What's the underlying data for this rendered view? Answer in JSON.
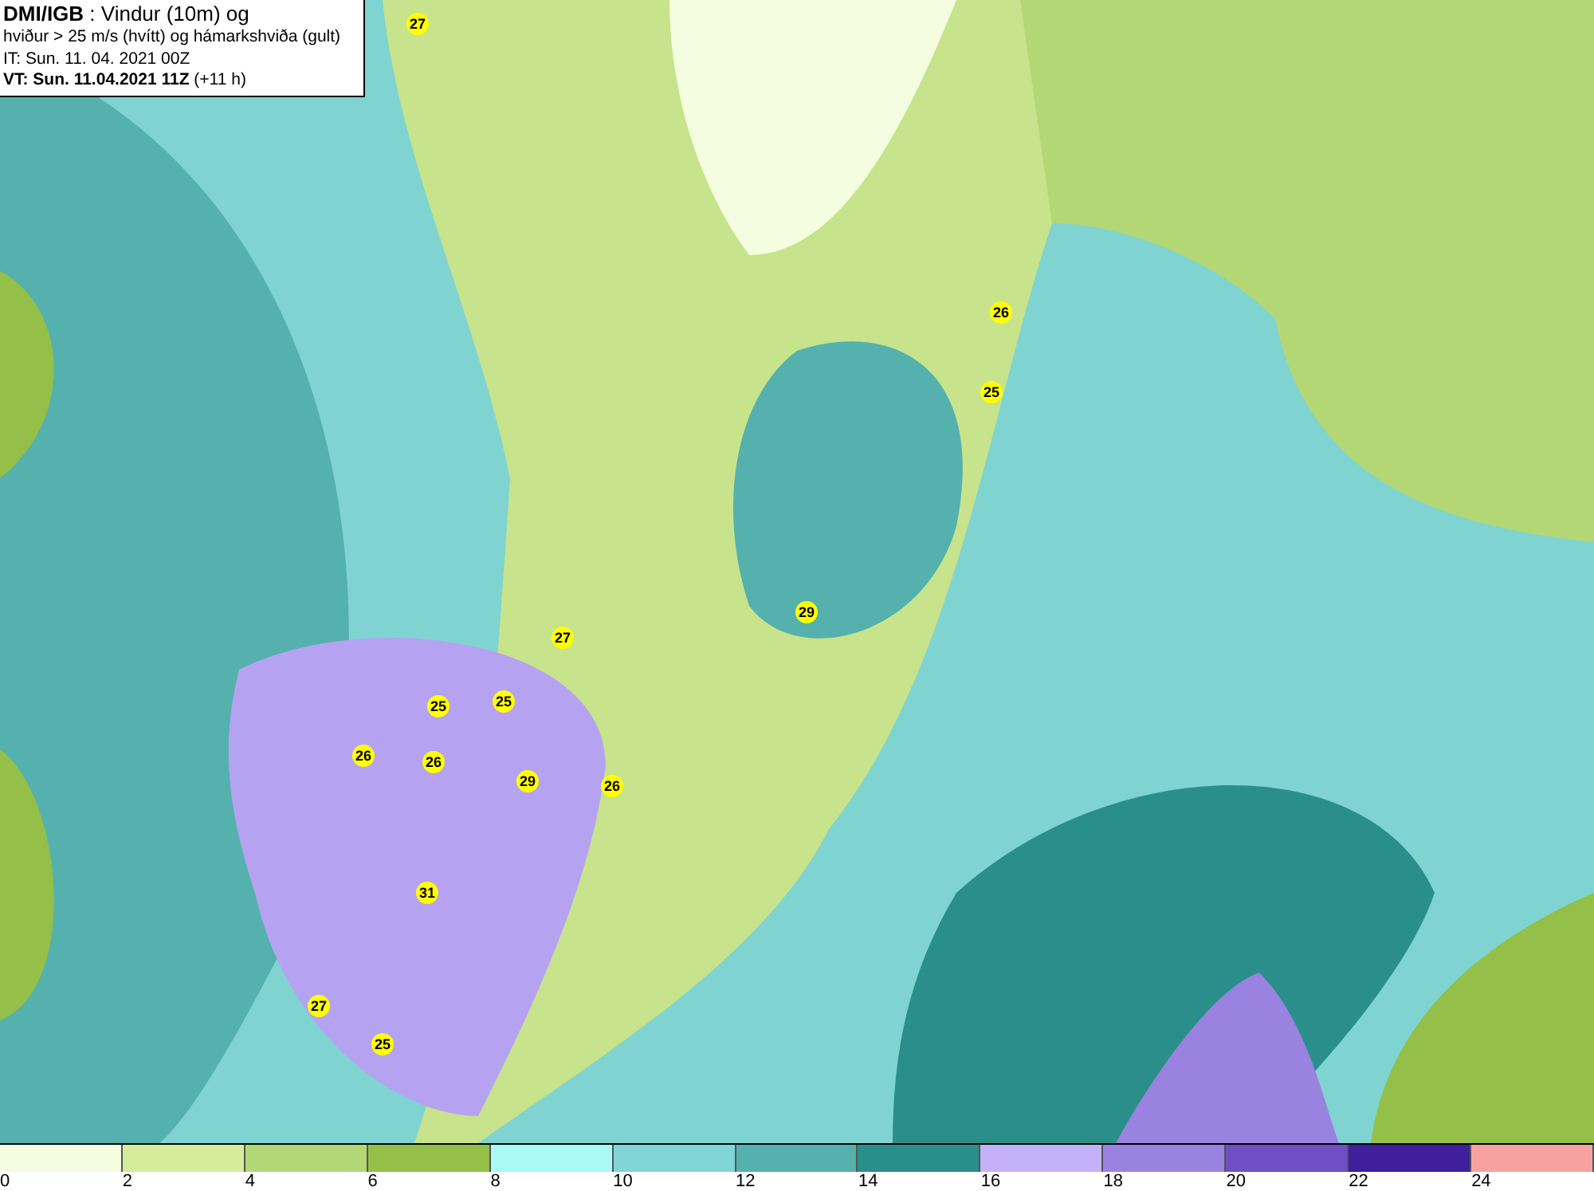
{
  "title_box": {
    "lines": [
      "**DMI/IGB** : Vindur (10m) og",
      "hviður > 25 m/s (hvítt) og hámarkshviða (gult)",
      "IT: Sun. 11. 04. 2021 00Z",
      "**VT: Sun. 11.04.2021 11Z** (+11 h)"
    ]
  },
  "gust_labels": [
    "27",
    "26",
    "25",
    "29",
    "27",
    "25",
    "25",
    "26",
    "26",
    "29",
    "26",
    "31",
    "27",
    "25"
  ],
  "legend": [
    {
      "value": "0",
      "color": "#f5fde0"
    },
    {
      "value": "2",
      "color": "#d5ec9b"
    },
    {
      "value": "4",
      "color": "#b3d774"
    },
    {
      "value": "6",
      "color": "#94bf48"
    },
    {
      "value": "8",
      "color": "#aaf9f7"
    },
    {
      "value": "10",
      "color": "#80d6d5"
    },
    {
      "value": "12",
      "color": "#55b1ae"
    },
    {
      "value": "14",
      "color": "#2a8f8a"
    },
    {
      "value": "16",
      "color": "#c4b1f8"
    },
    {
      "value": "18",
      "color": "#9a82e0"
    },
    {
      "value": "20",
      "color": "#6e4fc4"
    },
    {
      "value": "22",
      "color": "#3f1f9b"
    },
    {
      "value": "24",
      "color": "#f7a1a1"
    }
  ]
}
